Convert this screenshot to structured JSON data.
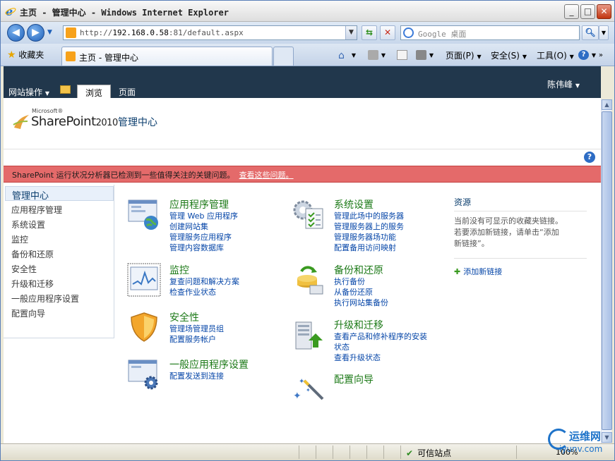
{
  "window": {
    "title": "主页 - 管理中心 - Windows Internet Explorer"
  },
  "browser": {
    "url_prefix": "http://",
    "url_host": "192.168.0.58",
    "url_rest": ":81/default.aspx",
    "search_placeholder": "Google 桌面",
    "favorites_label": "收藏夹",
    "tab_title": "主页 - 管理中心",
    "commands": {
      "page": "页面(P)",
      "safety": "安全(S)",
      "tools": "工具(O)"
    }
  },
  "sharepoint": {
    "site_actions": "网站操作",
    "ribbon_tabs": [
      "浏览",
      "页面"
    ],
    "user_name": "陈伟峰",
    "logo": {
      "microsoft": "Microsoft®",
      "product": "SharePoint",
      "version": "2010"
    },
    "site_title": "管理中心",
    "alert": {
      "message": "SharePoint 运行状况分析器已检测到一些值得关注的关键问题。",
      "link": "查看这些问题。"
    },
    "left_nav": {
      "header": "管理中心",
      "items": [
        "应用程序管理",
        "系统设置",
        "监控",
        "备份和还原",
        "安全性",
        "升级和迁移",
        "一般应用程序设置",
        "配置向导"
      ]
    },
    "categories": {
      "app_mgmt": {
        "title": "应用程序管理",
        "links": [
          "管理 Web 应用程序",
          "创建网站集",
          "管理服务应用程序",
          "管理内容数据库"
        ]
      },
      "monitoring": {
        "title": "监控",
        "links": [
          "复查问题和解决方案",
          "检查作业状态"
        ]
      },
      "security": {
        "title": "安全性",
        "links": [
          "管理场管理员组",
          "配置服务帐户"
        ]
      },
      "general": {
        "title": "一般应用程序设置",
        "links": [
          "配置发送到连接"
        ]
      },
      "system": {
        "title": "系统设置",
        "links": [
          "管理此场中的服务器",
          "管理服务器上的服务",
          "管理服务器场功能",
          "配置备用访问映射"
        ]
      },
      "backup": {
        "title": "备份和还原",
        "links": [
          "执行备份",
          "从备份还原",
          "执行网站集备份"
        ]
      },
      "upgrade": {
        "title": "升级和迁移",
        "links": [
          "查看产品和修补程序的安装",
          "状态",
          "查看升级状态"
        ]
      },
      "wizard": {
        "title": "配置向导",
        "links": []
      }
    },
    "resources": {
      "title": "资源",
      "text1": "当前没有可显示的收藏夹链接。",
      "text2": "若要添加新链接，请单击“添加",
      "text3": "新链接”。",
      "add_link": "添加新链接"
    }
  },
  "status": {
    "zone": "可信站点",
    "zoom": "100%"
  },
  "watermark": {
    "line1": "运维网",
    "line2": "iyunv.com"
  }
}
